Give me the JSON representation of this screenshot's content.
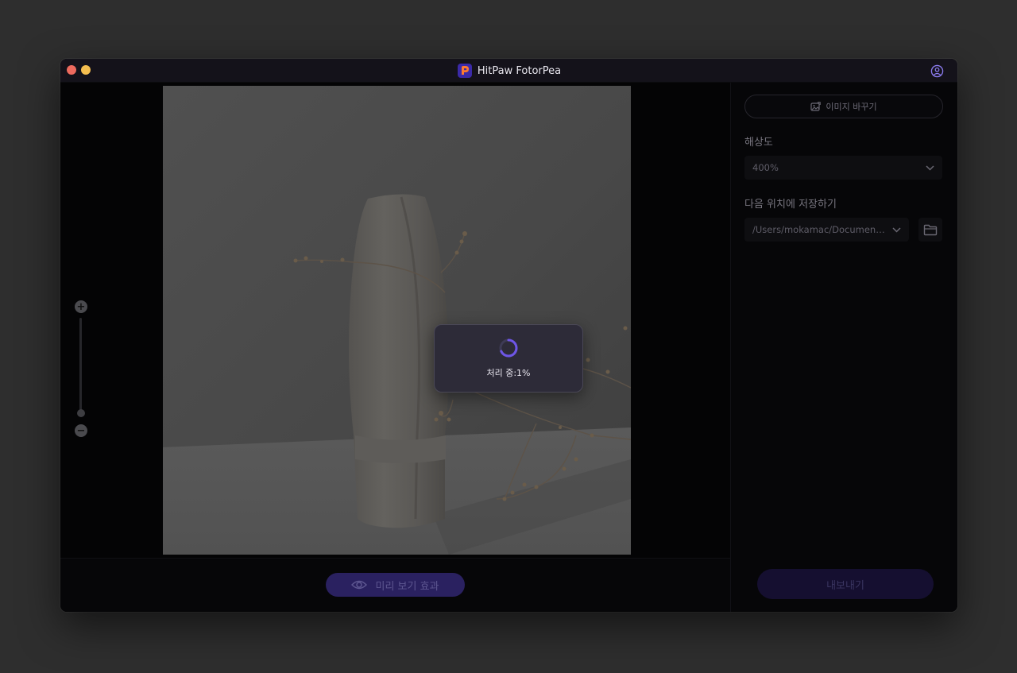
{
  "window": {
    "title": "HitPaw FotorPea"
  },
  "canvas": {
    "processing": {
      "label": "처리 중:1%",
      "progress_percent": 1
    },
    "zoom": {
      "plus_symbol": "+",
      "minus_symbol": "−"
    }
  },
  "bottom_bar": {
    "preview_label": "미리 보기 효과"
  },
  "panel": {
    "replace_image_label": "이미지 바꾸기",
    "resolution_label": "해상도",
    "resolution_value": "400%",
    "save_location_label": "다음 위치에 저장하기",
    "save_path_value": "/Users/mokamac/Documents/...",
    "export_label": "내보내기"
  },
  "colors": {
    "accent": "#6e56e6",
    "app_logo_primary": "#7b4bff",
    "app_logo_secondary": "#ff7a2e"
  },
  "icons": {
    "account": "user-circle-icon",
    "preview": "eye-icon",
    "replace_image": "image-swap-icon",
    "dropdown": "chevron-down-icon",
    "folder": "folder-icon",
    "spinner": "loading-spinner-icon"
  }
}
